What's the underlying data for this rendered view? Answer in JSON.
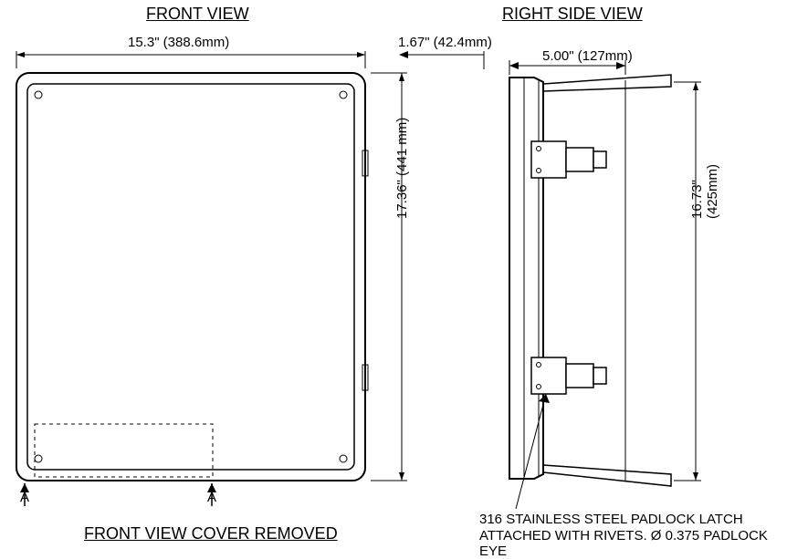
{
  "titles": {
    "front": "FRONT VIEW",
    "right": "RIGHT SIDE VIEW",
    "front_removed": "FRONT VIEW COVER REMOVED"
  },
  "dims": {
    "width_front": "15.3\" (388.6mm)",
    "depth_small": "1.67\" (42.4mm)",
    "depth_side": "5.00\" (127mm)",
    "height_front": "17.36\" (441 mm)",
    "height_side": "16.73\" (425mm)"
  },
  "sections": {
    "a_left": "A",
    "a_right": "A"
  },
  "notes": {
    "latch_line1": "316 STAINLESS STEEL PADLOCK LATCH",
    "latch_line2": "ATTACHED WITH RIVETS. Ø 0.375 PADLOCK EYE"
  }
}
